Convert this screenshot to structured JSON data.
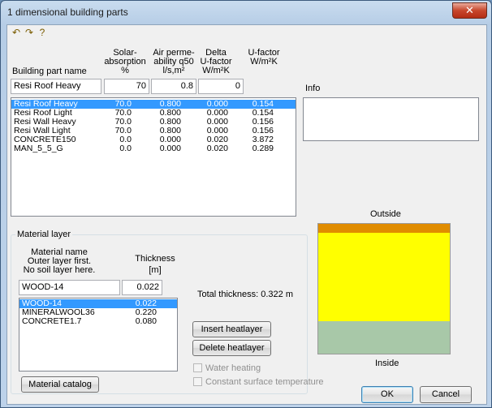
{
  "window": {
    "title": "1 dimensional building parts",
    "close_glyph": "✕"
  },
  "toolbar": {
    "icons": [
      "undo-icon",
      "redo-icon",
      "help-icon"
    ]
  },
  "headers": {
    "building_part_name": "Building part name",
    "solar_1": "Solar-",
    "solar_2": "absorption",
    "solar_3": "%",
    "air_1": "Air perme-",
    "air_2": "ability q50",
    "air_3": "l/s,m²",
    "delta_1": "Delta",
    "delta_2": "U-factor",
    "delta_3": "W/m²K",
    "ufactor_1": "U-factor",
    "ufactor_2": "W/m²K"
  },
  "edit_row": {
    "name": "Resi Roof Heavy",
    "solar": "70",
    "air": "0.8",
    "delta": "0"
  },
  "parts": [
    {
      "name": "Resi Roof Heavy",
      "solar": "70.0",
      "air": "0.800",
      "delta": "0.000",
      "u": "0.154",
      "selected": true
    },
    {
      "name": "Resi Roof Light",
      "solar": "70.0",
      "air": "0.800",
      "delta": "0.000",
      "u": "0.154"
    },
    {
      "name": "Resi Wall Heavy",
      "solar": "70.0",
      "air": "0.800",
      "delta": "0.000",
      "u": "0.156"
    },
    {
      "name": "Resi Wall Light",
      "solar": "70.0",
      "air": "0.800",
      "delta": "0.000",
      "u": "0.156"
    },
    {
      "name": "CONCRETE150",
      "solar": "0.0",
      "air": "0.000",
      "delta": "0.020",
      "u": "3.872"
    },
    {
      "name": "MAN_5_5_G",
      "solar": "0.0",
      "air": "0.000",
      "delta": "0.020",
      "u": "0.289"
    }
  ],
  "info": {
    "label": "Info",
    "text": ""
  },
  "material": {
    "group_label": "Material layer",
    "name_hdr_1": "Material name",
    "name_hdr_2": "Outer layer first.",
    "name_hdr_3": "No soil layer here.",
    "thick_hdr_1": "Thickness",
    "thick_hdr_2": "[m]",
    "edit_name": "WOOD-14",
    "edit_thickness": "0.022",
    "total": "Total thickness: 0.322 m",
    "layers": [
      {
        "name": "WOOD-14",
        "thickness": "0.022",
        "selected": true
      },
      {
        "name": "MINERALWOOL36",
        "thickness": "0.220"
      },
      {
        "name": "CONCRETE1.7",
        "thickness": "0.080"
      }
    ],
    "insert_button": "Insert heatlayer",
    "delete_button": "Delete heatlayer",
    "water_heating": "Water heating",
    "constant_surface": "Constant surface temperature",
    "catalog_button": "Material catalog"
  },
  "section": {
    "outside_label": "Outside",
    "inside_label": "Inside",
    "layers": [
      {
        "name": "WOOD-14",
        "thickness": 0.022,
        "color": "#e08c00"
      },
      {
        "name": "MINERALWOOL36",
        "thickness": 0.22,
        "color": "#ffff00"
      },
      {
        "name": "CONCRETE1.7",
        "thickness": 0.08,
        "color": "#a8c8a8"
      }
    ]
  },
  "buttons": {
    "ok": "OK",
    "cancel": "Cancel"
  }
}
